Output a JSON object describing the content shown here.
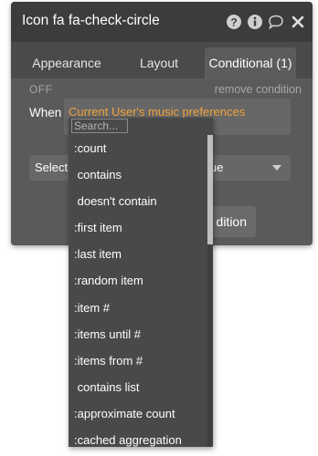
{
  "window": {
    "title": "Icon fa fa-check-circle",
    "icons": [
      "help-circle-icon",
      "info-circle-icon",
      "comment-icon",
      "close-icon"
    ]
  },
  "tabs": [
    {
      "label": "Appearance",
      "active": false
    },
    {
      "label": "Layout",
      "active": false
    },
    {
      "label": "Conditional (1)",
      "active": true
    }
  ],
  "condition": {
    "status": "OFF",
    "remove_label": "remove condition",
    "when_label": "When",
    "expression": "Current User's music preferences"
  },
  "select_row": {
    "label": "Select",
    "value": "ue"
  },
  "action_button": {
    "label": "dition"
  },
  "dropdown": {
    "search_placeholder": "Search...",
    "options": [
      ":count",
      " contains",
      " doesn't contain",
      ":first item",
      ":last item",
      ":random item",
      ":item #",
      ":items until #",
      ":items from #",
      " contains list",
      ":approximate count",
      ":cached aggregation"
    ]
  },
  "colors": {
    "panel_bg": "#4a4a4a",
    "titlebar_bg": "#3c3c3c",
    "expression_text": "#f0a33c",
    "dropdown_bg": "#494949"
  }
}
